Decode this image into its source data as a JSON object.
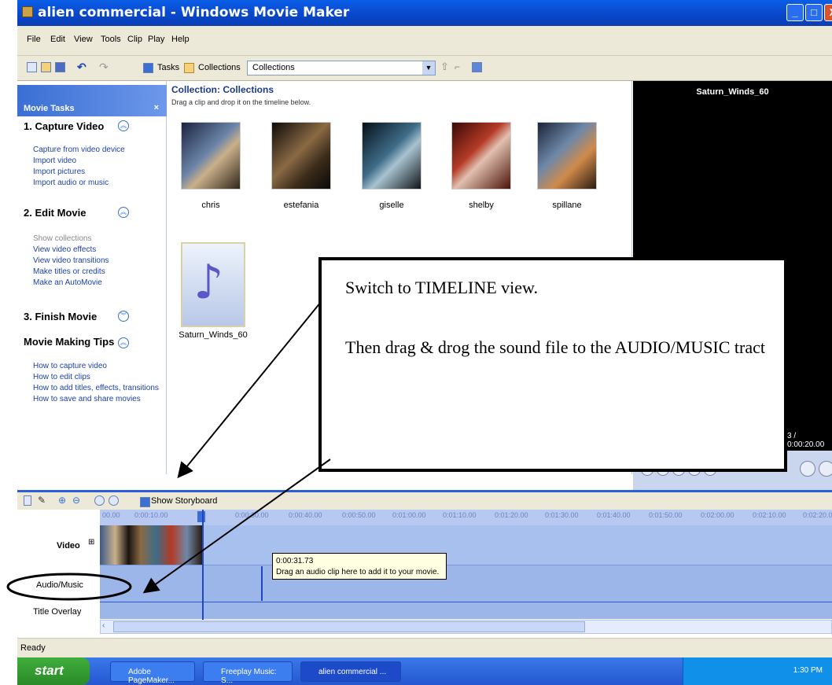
{
  "window": {
    "title": "alien commercial - Windows Movie Maker",
    "minimize": "_",
    "maximize": "□",
    "close": "X"
  },
  "menu": [
    "File",
    "Edit",
    "View",
    "Tools",
    "Clip",
    "Play",
    "Help"
  ],
  "toolbar": {
    "tasks": "Tasks",
    "collections": "Collections",
    "collection_select": "Collections"
  },
  "tasks": {
    "header": "Movie Tasks",
    "close": "×",
    "capture": {
      "title": "1. Capture Video",
      "links": [
        "Capture from video device",
        "Import video",
        "Import pictures",
        "Import audio or music"
      ]
    },
    "edit": {
      "title": "2. Edit Movie",
      "links": [
        "Show collections",
        "View video effects",
        "View video transitions",
        "Make titles or credits",
        "Make an AutoMovie"
      ]
    },
    "finish": {
      "title": "3. Finish Movie"
    },
    "tips": {
      "title": "Movie Making Tips",
      "links": [
        "How to capture video",
        "How to edit clips",
        "How to add titles, effects, transitions",
        "How to save and share movies"
      ]
    }
  },
  "collection": {
    "title": "Collection: Collections",
    "subtitle": "Drag a clip and drop it on the timeline below.",
    "clips": [
      "chris",
      "estefania",
      "giselle",
      "shelby",
      "spillane",
      "Saturn_Winds_60"
    ]
  },
  "preview": {
    "title": "Saturn_Winds_60",
    "time": "3 / 0:00:20.00"
  },
  "callout": {
    "line1": "Switch to TIMELINE view.",
    "line2": "Then drag & drog the sound file to the AUDIO/MUSIC tract"
  },
  "timeline": {
    "show_storyboard": "Show Storyboard",
    "ruler": [
      "00.00",
      "0:00:10.00",
      "0:00:30.00",
      "0:00:40.00",
      "0:00:50.00",
      "0:01:00.00",
      "0:01:10.00",
      "0:01:20.00",
      "0:01:30.00",
      "0:01:40.00",
      "0:01:50.00",
      "0:02:00.00",
      "0:02:10.00",
      "0:02:20.00"
    ],
    "tracks": {
      "video": "Video",
      "audio": "Audio/Music",
      "title": "Title Overlay"
    },
    "tooltip_time": "0:00:31.73",
    "tooltip_text": "Drag an audio clip here to add it to your movie."
  },
  "status": "Ready",
  "taskbar": {
    "start": "start",
    "items": [
      "Adobe PageMaker...",
      "Freeplay Music: S...",
      "alien commercial ..."
    ],
    "clock": "1:30 PM"
  }
}
